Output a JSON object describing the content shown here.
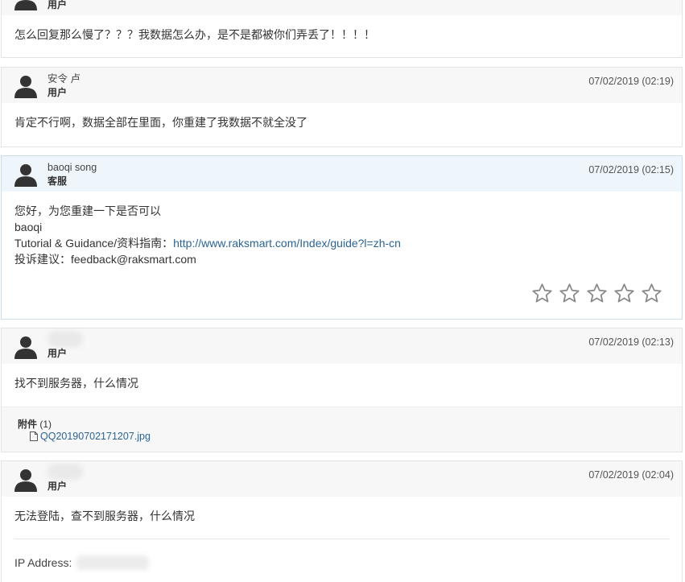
{
  "messages": [
    {
      "role": "用户",
      "body": [
        "怎么回复那么慢了？？？我数据怎么办，是不是都被你们弄丢了！！！！"
      ]
    },
    {
      "author": "安令 卢",
      "role": "用户",
      "date": "07/02/2019 (02:19)",
      "body": [
        "肯定不行啊，数据全部在里面，你重建了我数据不就全没了"
      ]
    },
    {
      "author": "baoqi song",
      "role": "客服",
      "date": "07/02/2019 (02:15)",
      "body": [
        "您好，为您重建一下是否可以",
        "baoqi"
      ],
      "guide_label": "Tutorial & Guidance/资料指南：",
      "guide_link": "http://www.raksmart.com/Index/guide?l=zh-cn",
      "feedback": "投诉建议：feedback@raksmart.com",
      "rating_icons": [
        "star-outline",
        "star-outline",
        "star-outline",
        "star-outline",
        "star-outline"
      ]
    },
    {
      "role": "用户",
      "date": "07/02/2019 (02:13)",
      "body": [
        "找不到服务器，什么情况"
      ],
      "attachments_label": "附件",
      "attachments_count": "(1)",
      "attachment_file": "QQ20190702171207.jpg"
    },
    {
      "role": "用户",
      "date": "07/02/2019 (02:04)",
      "body": [
        "无法登陆，查不到服务器，什么情况"
      ],
      "ip_label": "IP Address:"
    }
  ],
  "colors": {
    "link": "#2a6496",
    "header_bg": "#f7f7f7",
    "staff_header_bg": "#eef6fb",
    "star": "#8a8a8a"
  }
}
